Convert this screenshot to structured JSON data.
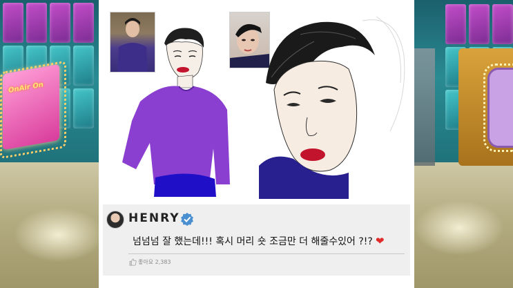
{
  "post": {
    "username": "HENRY",
    "comment": "넘넘넘 잘 했는데!!! 혹시 머리 숏 조금만 더 해줄수있어 ?!?",
    "heart": "❤",
    "likes": "좋아요 2,383"
  },
  "backdrop": {
    "sign_text": "OnAir On"
  },
  "colors": {
    "sweater": "#8a3fd0",
    "lips": "#c2142c",
    "card_bg": "#ffffff",
    "post_bg": "#efefef",
    "verified": "#4a8fd0",
    "heart": "#e02b2b"
  },
  "icons": [
    "verified-badge-icon",
    "thumbs-up-icon",
    "heart-icon"
  ]
}
